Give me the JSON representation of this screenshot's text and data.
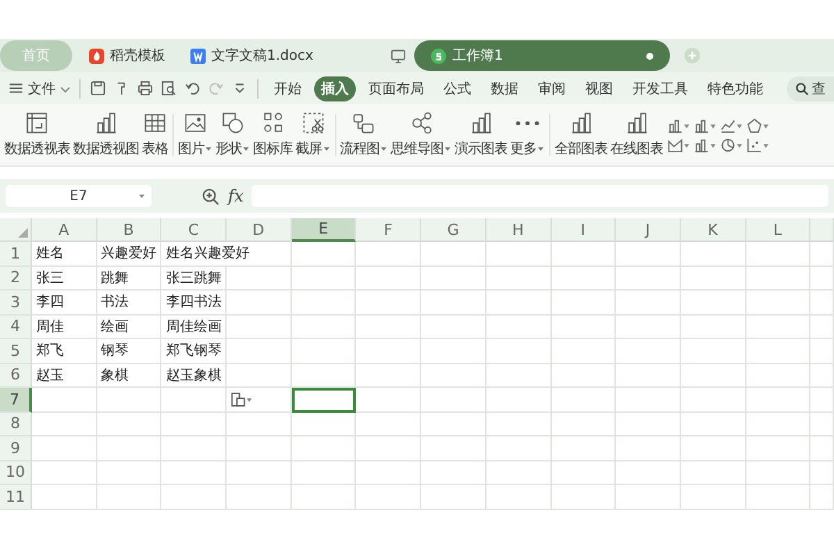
{
  "tabs": [
    {
      "label": "首页",
      "kind": "home",
      "selected": false
    },
    {
      "label": "稻壳模板",
      "kind": "docer",
      "selected": false
    },
    {
      "label": "文字文稿1.docx",
      "kind": "writer",
      "selected": false
    },
    {
      "label": "工作簿1",
      "kind": "sheet",
      "selected": true
    }
  ],
  "menu": {
    "file": "文件",
    "items": [
      {
        "label": "开始",
        "selected": false
      },
      {
        "label": "插入",
        "selected": true
      },
      {
        "label": "页面布局",
        "selected": false
      },
      {
        "label": "公式",
        "selected": false
      },
      {
        "label": "数据",
        "selected": false
      },
      {
        "label": "审阅",
        "selected": false
      },
      {
        "label": "视图",
        "selected": false
      },
      {
        "label": "开发工具",
        "selected": false
      },
      {
        "label": "特色功能",
        "selected": false
      }
    ],
    "search": "查"
  },
  "ribbon": [
    {
      "label": "数据透视表",
      "kind": "pivot-table",
      "dropdown": false
    },
    {
      "label": "数据透视图",
      "kind": "pivot-chart",
      "dropdown": false
    },
    {
      "label": "表格",
      "kind": "table",
      "dropdown": false
    },
    {
      "label": "图片",
      "kind": "picture",
      "dropdown": true
    },
    {
      "label": "形状",
      "kind": "shapes",
      "dropdown": true
    },
    {
      "label": "图标库",
      "kind": "icons",
      "dropdown": false
    },
    {
      "label": "截屏",
      "kind": "screenshot",
      "dropdown": true
    },
    {
      "label": "流程图",
      "kind": "flowchart",
      "dropdown": true
    },
    {
      "label": "思维导图",
      "kind": "mindmap",
      "dropdown": true
    },
    {
      "label": "演示图表",
      "kind": "demo-chart",
      "dropdown": false
    },
    {
      "label": "更多",
      "kind": "more",
      "dropdown": true
    },
    {
      "label": "全部图表",
      "kind": "all-charts",
      "dropdown": false
    },
    {
      "label": "在线图表",
      "kind": "online-chart",
      "dropdown": false
    }
  ],
  "name_box": "E7",
  "fx": "fx",
  "sheet": {
    "columns": [
      {
        "label": "A",
        "selected": false
      },
      {
        "label": "B",
        "selected": false
      },
      {
        "label": "C",
        "selected": false
      },
      {
        "label": "D",
        "selected": false
      },
      {
        "label": "E",
        "selected": true
      },
      {
        "label": "F",
        "selected": false
      },
      {
        "label": "G",
        "selected": false
      },
      {
        "label": "H",
        "selected": false
      },
      {
        "label": "I",
        "selected": false
      },
      {
        "label": "J",
        "selected": false
      },
      {
        "label": "K",
        "selected": false
      },
      {
        "label": "L",
        "selected": false
      }
    ],
    "rows": [
      {
        "label": "1",
        "selected": false,
        "cells": [
          "姓名",
          "兴趣爱好",
          "姓名兴趣爱好"
        ]
      },
      {
        "label": "2",
        "selected": false,
        "cells": [
          "张三",
          "跳舞",
          "张三跳舞"
        ]
      },
      {
        "label": "3",
        "selected": false,
        "cells": [
          "李四",
          "书法",
          "李四书法"
        ]
      },
      {
        "label": "4",
        "selected": false,
        "cells": [
          "周佳",
          "绘画",
          "周佳绘画"
        ]
      },
      {
        "label": "5",
        "selected": false,
        "cells": [
          "郑飞",
          "钢琴",
          "郑飞钢琴"
        ]
      },
      {
        "label": "6",
        "selected": false,
        "cells": [
          "赵玉",
          "象棋",
          "赵玉象棋"
        ]
      },
      {
        "label": "7",
        "selected": true,
        "cells": []
      },
      {
        "label": "8",
        "selected": false,
        "cells": []
      },
      {
        "label": "9",
        "selected": false,
        "cells": []
      },
      {
        "label": "10",
        "selected": false,
        "cells": []
      },
      {
        "label": "11",
        "selected": false,
        "cells": []
      }
    ]
  }
}
